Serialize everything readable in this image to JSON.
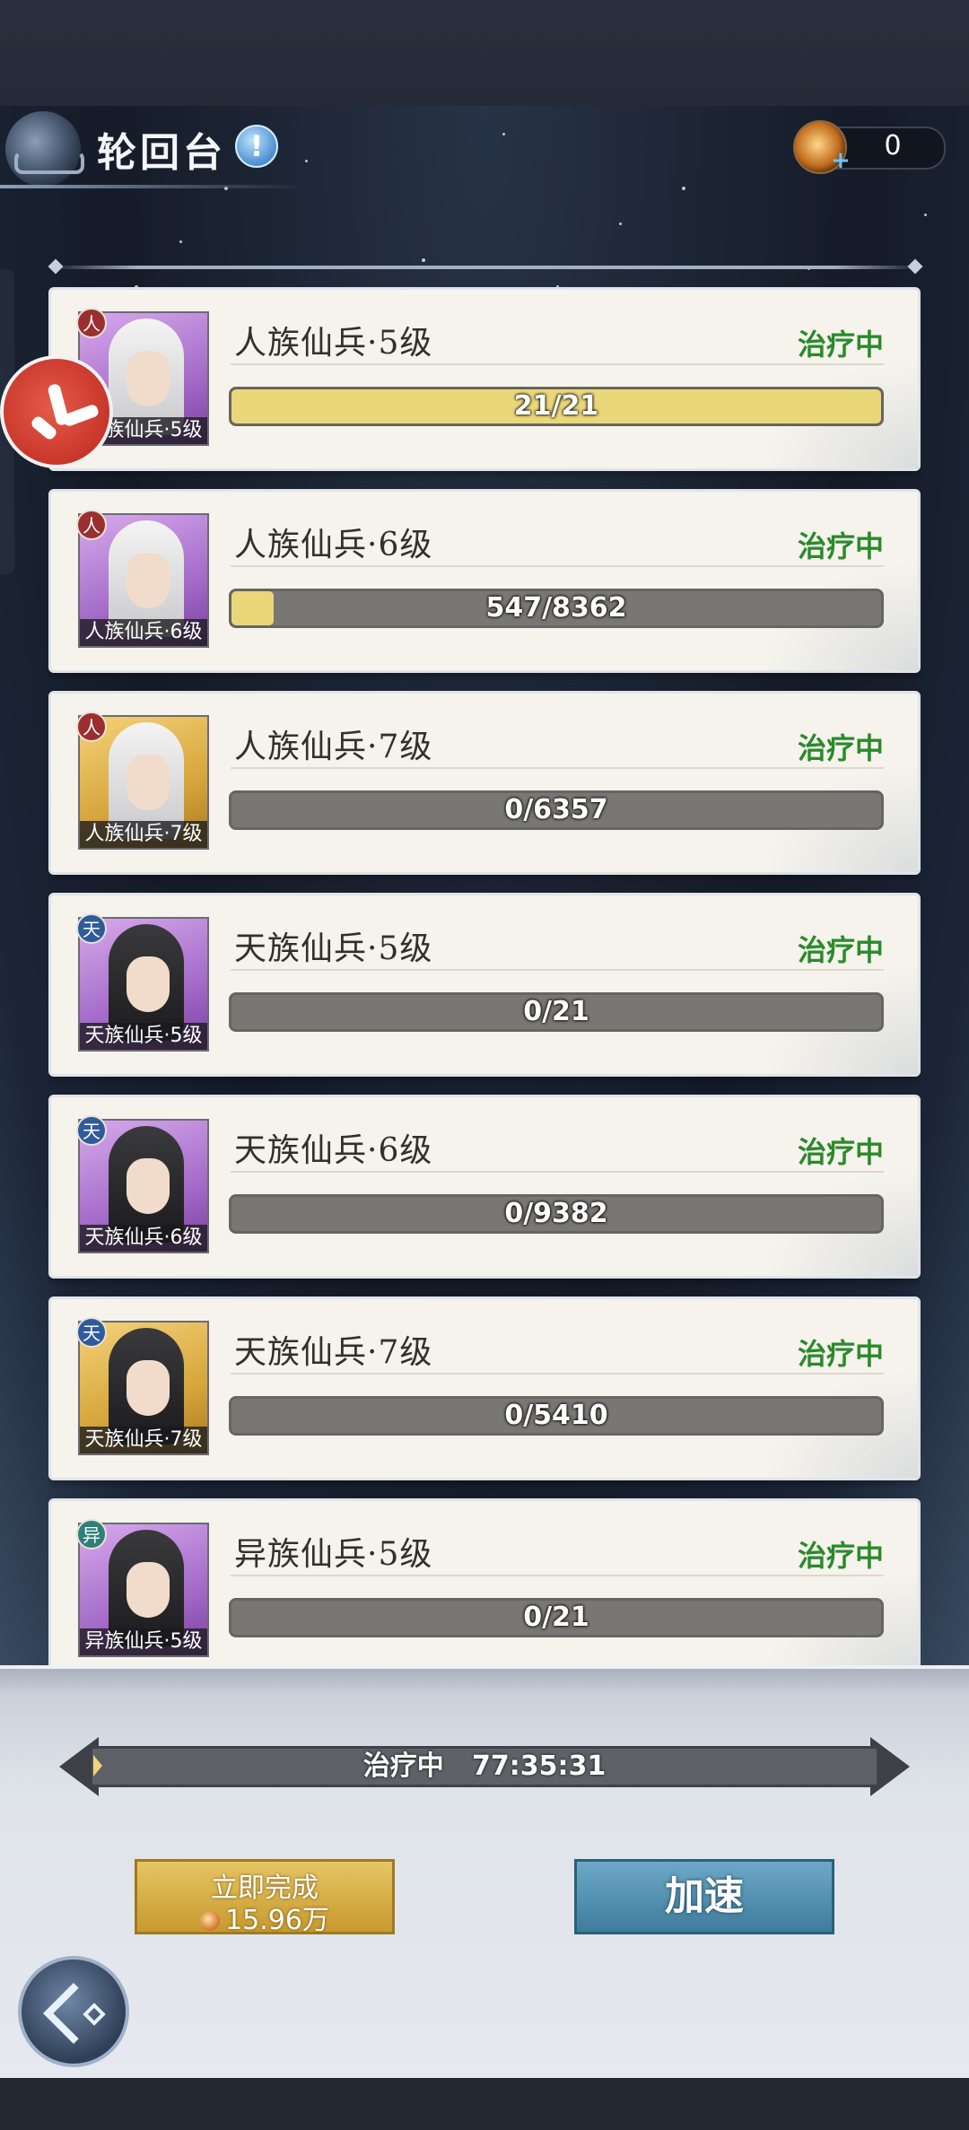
{
  "header": {
    "title": "轮回台",
    "info_icon": "!",
    "currency": {
      "icon": "coin-icon",
      "value": "0"
    }
  },
  "units": [
    {
      "avatar_caption": "人族仙兵·5级",
      "race_badge": "人",
      "race_color": "#9b2f2f",
      "portrait_bg": "purple",
      "hair": "white",
      "name": "人族仙兵·5级",
      "status": "治疗中",
      "progress_text": "21/21",
      "progress_fraction": 1.0
    },
    {
      "avatar_caption": "人族仙兵·6级",
      "race_badge": "人",
      "race_color": "#9b2f2f",
      "portrait_bg": "purple",
      "hair": "white",
      "name": "人族仙兵·6级",
      "status": "治疗中",
      "progress_text": "547/8362",
      "progress_fraction": 0.065
    },
    {
      "avatar_caption": "人族仙兵·7级",
      "race_badge": "人",
      "race_color": "#9b2f2f",
      "portrait_bg": "gold",
      "hair": "white",
      "name": "人族仙兵·7级",
      "status": "治疗中",
      "progress_text": "0/6357",
      "progress_fraction": 0
    },
    {
      "avatar_caption": "天族仙兵·5级",
      "race_badge": "天",
      "race_color": "#2f5b9b",
      "portrait_bg": "purple",
      "hair": "black",
      "name": "天族仙兵·5级",
      "status": "治疗中",
      "progress_text": "0/21",
      "progress_fraction": 0
    },
    {
      "avatar_caption": "天族仙兵·6级",
      "race_badge": "天",
      "race_color": "#2f5b9b",
      "portrait_bg": "purple",
      "hair": "black",
      "name": "天族仙兵·6级",
      "status": "治疗中",
      "progress_text": "0/9382",
      "progress_fraction": 0
    },
    {
      "avatar_caption": "天族仙兵·7级",
      "race_badge": "天",
      "race_color": "#2f5b9b",
      "portrait_bg": "gold",
      "hair": "black",
      "name": "天族仙兵·7级",
      "status": "治疗中",
      "progress_text": "0/5410",
      "progress_fraction": 0
    },
    {
      "avatar_caption": "异族仙兵·5级",
      "race_badge": "异",
      "race_color": "#2f7f7a",
      "portrait_bg": "purple",
      "hair": "black",
      "name": "异族仙兵·5级",
      "status": "治疗中",
      "progress_text": "0/21",
      "progress_fraction": 0
    }
  ],
  "footer": {
    "timer_status": "治疗中",
    "timer_value": "77:35:31",
    "finish_button": {
      "line1": "立即完成",
      "cost": "15.96万"
    },
    "speedup_button": "加速"
  },
  "colors": {
    "status_green": "#2b8a2b",
    "progress_fill": "#ead77a",
    "progress_track": "#787773"
  }
}
